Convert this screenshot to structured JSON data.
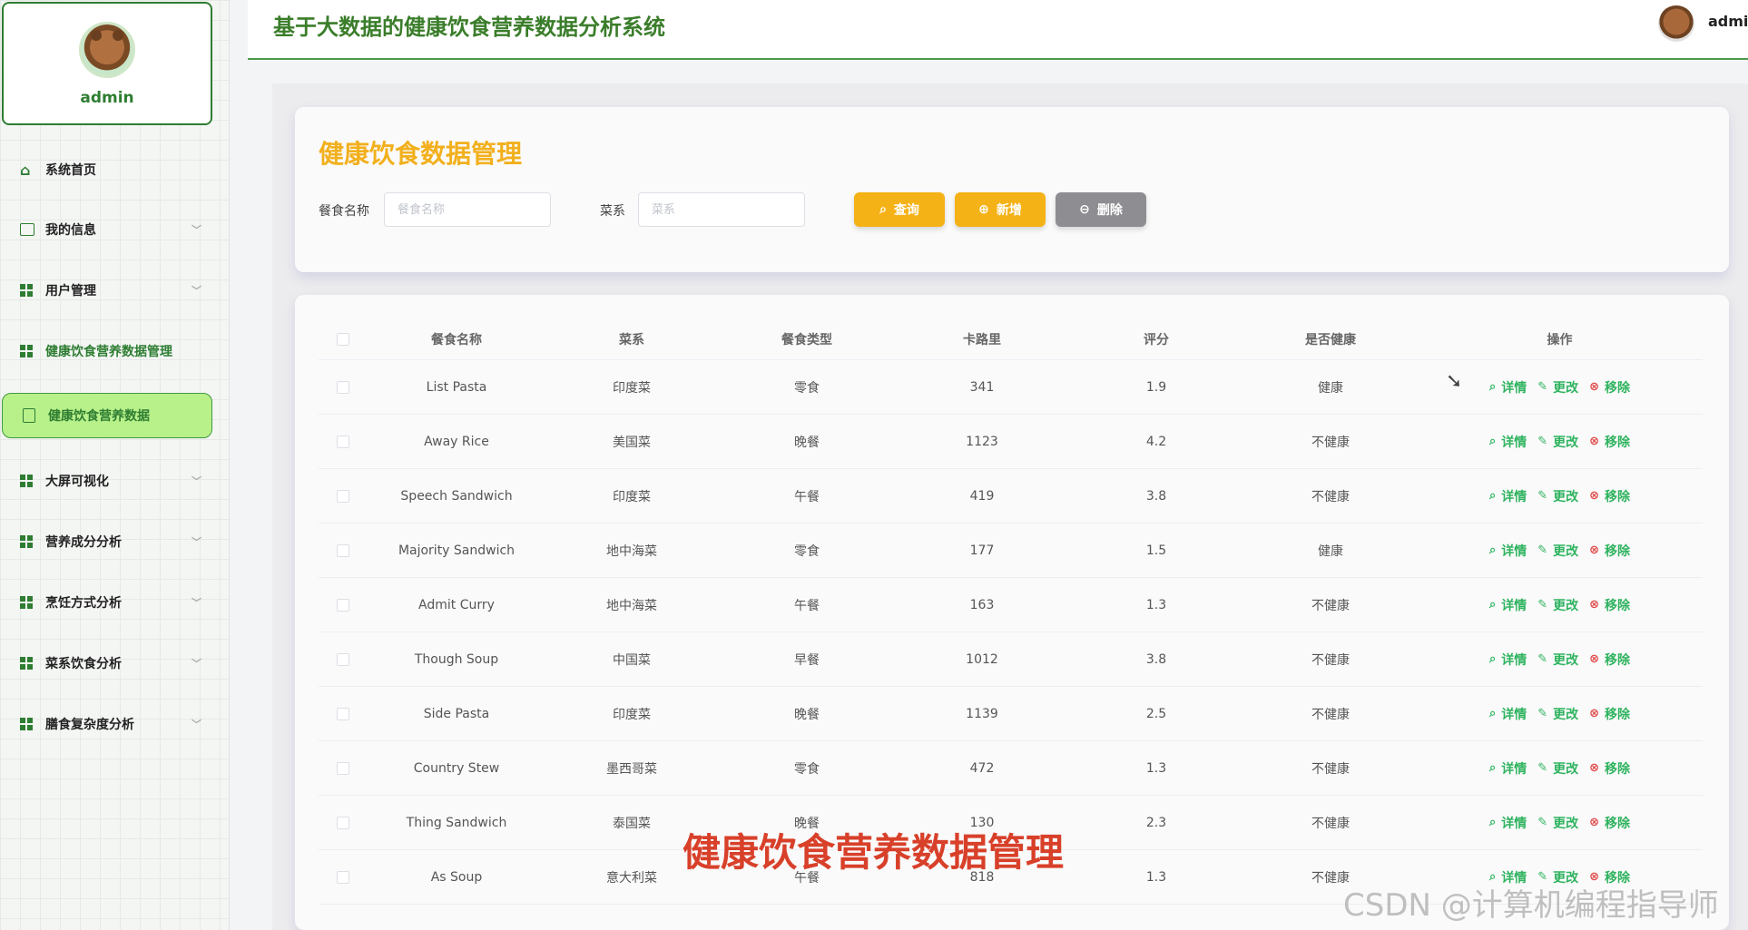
{
  "app": {
    "title": "基于大数据的健康饮食营养数据分析系统",
    "user": "admin"
  },
  "sidebar": {
    "profile_name": "admin",
    "items": [
      {
        "label": "系统首页"
      },
      {
        "label": "我的信息"
      },
      {
        "label": "用户管理"
      },
      {
        "label": "健康饮食营养数据管理"
      },
      {
        "label": "大屏可视化"
      },
      {
        "label": "营养成分分析"
      },
      {
        "label": "烹饪方式分析"
      },
      {
        "label": "菜系饮食分析"
      },
      {
        "label": "膳食复杂度分析"
      }
    ],
    "active_sub": "健康饮食营养数据"
  },
  "search": {
    "title": "健康饮食数据管理",
    "name_label": "餐食名称",
    "name_placeholder": "餐食名称",
    "cuisine_label": "菜系",
    "cuisine_placeholder": "菜系",
    "query_btn": "查询",
    "add_btn": "新增",
    "delete_btn": "删除"
  },
  "table": {
    "headers": [
      "餐食名称",
      "菜系",
      "餐食类型",
      "卡路里",
      "评分",
      "是否健康",
      "操作"
    ],
    "ops": {
      "detail": "详情",
      "edit": "更改",
      "remove": "移除"
    },
    "rows": [
      {
        "name": "List Pasta",
        "cuisine": "印度菜",
        "type": "零食",
        "calories": "341",
        "score": "1.9",
        "healthy": "健康"
      },
      {
        "name": "Away Rice",
        "cuisine": "美国菜",
        "type": "晚餐",
        "calories": "1123",
        "score": "4.2",
        "healthy": "不健康"
      },
      {
        "name": "Speech Sandwich",
        "cuisine": "印度菜",
        "type": "午餐",
        "calories": "419",
        "score": "3.8",
        "healthy": "不健康"
      },
      {
        "name": "Majority Sandwich",
        "cuisine": "地中海菜",
        "type": "零食",
        "calories": "177",
        "score": "1.5",
        "healthy": "健康"
      },
      {
        "name": "Admit Curry",
        "cuisine": "地中海菜",
        "type": "午餐",
        "calories": "163",
        "score": "1.3",
        "healthy": "不健康"
      },
      {
        "name": "Though Soup",
        "cuisine": "中国菜",
        "type": "早餐",
        "calories": "1012",
        "score": "3.8",
        "healthy": "不健康"
      },
      {
        "name": "Side Pasta",
        "cuisine": "印度菜",
        "type": "晚餐",
        "calories": "1139",
        "score": "2.5",
        "healthy": "不健康"
      },
      {
        "name": "Country Stew",
        "cuisine": "墨西哥菜",
        "type": "零食",
        "calories": "472",
        "score": "1.3",
        "healthy": "不健康"
      },
      {
        "name": "Thing Sandwich",
        "cuisine": "泰国菜",
        "type": "晚餐",
        "calories": "130",
        "score": "2.3",
        "healthy": "不健康"
      },
      {
        "name": "As Soup",
        "cuisine": "意大利菜",
        "type": "午餐",
        "calories": "818",
        "score": "1.3",
        "healthy": "不健康"
      }
    ]
  },
  "overlay": {
    "caption": "健康饮食营养数据管理",
    "watermark": "CSDN @计算机编程指导师"
  }
}
